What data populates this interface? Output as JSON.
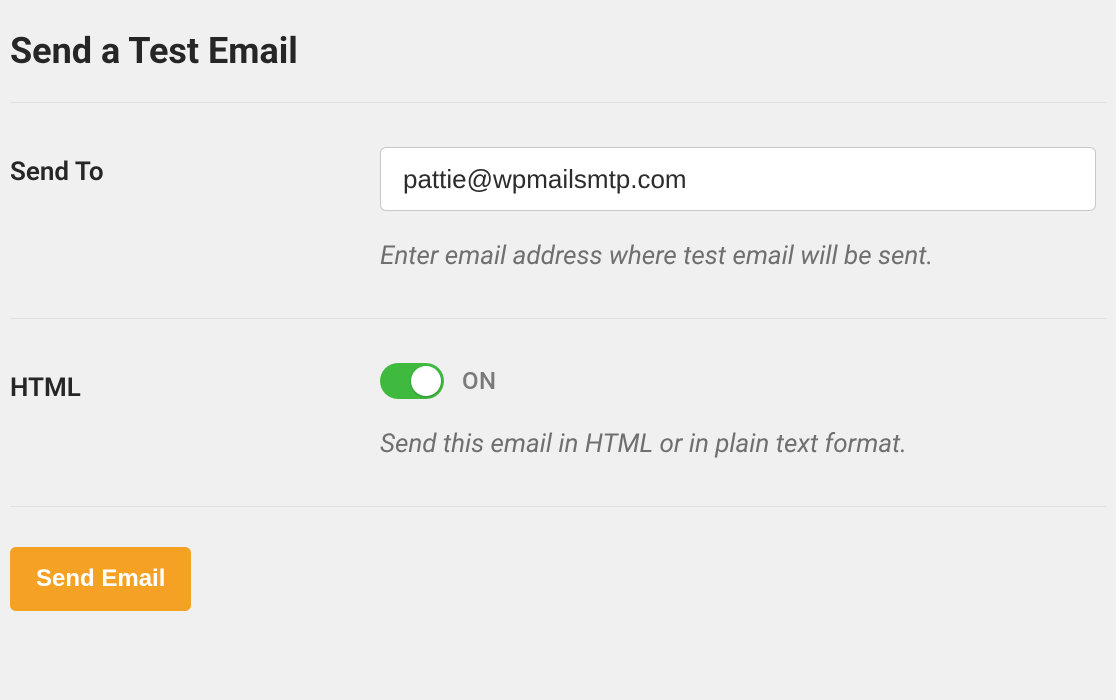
{
  "page": {
    "title": "Send a Test Email"
  },
  "fields": {
    "send_to": {
      "label": "Send To",
      "value": "pattie@wpmailsmtp.com",
      "help": "Enter email address where test email will be sent."
    },
    "html": {
      "label": "HTML",
      "state_label": "ON",
      "on": true,
      "help": "Send this email in HTML or in plain text format."
    }
  },
  "actions": {
    "send_label": "Send Email"
  },
  "colors": {
    "accent": "#f5a224",
    "toggle_on": "#3fba3f"
  }
}
